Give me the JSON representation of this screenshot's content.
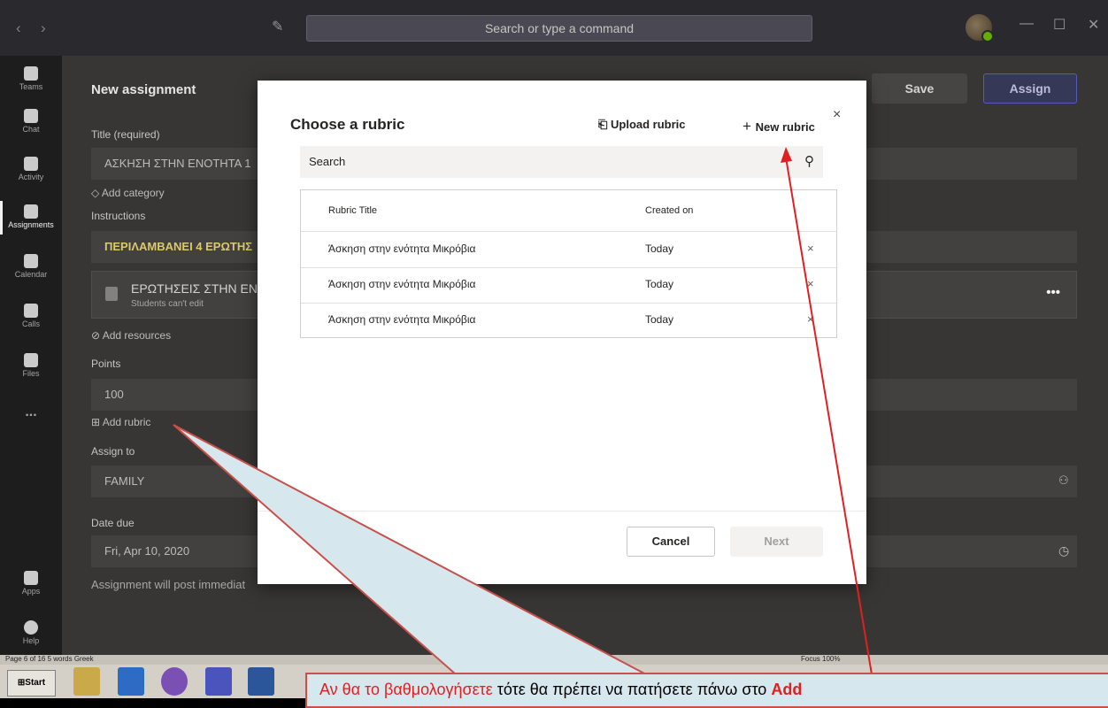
{
  "titlebar": {
    "nav_back": "‹",
    "nav_forward": "›",
    "search_placeholder": "Search or type a command",
    "minimize": "—",
    "maximize": "☐",
    "close": "✕"
  },
  "rail": [
    {
      "label": "Teams"
    },
    {
      "label": "Chat"
    },
    {
      "label": "Activity"
    },
    {
      "label": "Assignments"
    },
    {
      "label": "Calendar"
    },
    {
      "label": "Calls"
    },
    {
      "label": "Files"
    },
    {
      "label": "..."
    },
    {
      "label": "Apps"
    },
    {
      "label": "Help"
    }
  ],
  "page": {
    "title": "New assignment",
    "save": "Save",
    "assign": "Assign",
    "title_label": "Title (required)",
    "title_value": "ΑΣΚΗΣΗ ΣΤΗΝ ΕΝΟΤΗΤΑ 1",
    "add_category": "Add category",
    "instructions_label": "Instructions",
    "instructions_value": "ΠΕΡΙΛΑΜΒΑΝΕΙ 4 ΕΡΩΤΗΣ",
    "resource_title": "ΕΡΩΤΗΣΕΙΣ ΣΤΗΝ ΕΝ",
    "resource_sub": "Students can't edit",
    "more": "•••",
    "add_resources": "Add resources",
    "points_label": "Points",
    "points_value": "100",
    "add_rubric": "Add rubric",
    "assign_to_label": "Assign to",
    "assign_to_value": "FAMILY",
    "date_due_label": "Date due",
    "date_due_value": "Fri, Apr 10, 2020",
    "post_note": "Assignment will post immediat"
  },
  "modal": {
    "title": "Choose a rubric",
    "upload": "Upload rubric",
    "new": "New rubric",
    "close": "×",
    "search": "Search",
    "col_title": "Rubric Title",
    "col_created": "Created on",
    "rows": [
      {
        "title": "Άσκηση στην ενότητα Μικρόβια",
        "created": "Today"
      },
      {
        "title": "Άσκηση στην ενότητα Μικρόβια",
        "created": "Today"
      },
      {
        "title": "Άσκηση στην ενότητα Μικρόβια",
        "created": "Today"
      }
    ],
    "cancel": "Cancel",
    "next": "Next"
  },
  "statusbar": {
    "left": "Page 6 of 16    5 words    Greek",
    "right": "Focus                                        100%"
  },
  "taskbar": {
    "start": "Start"
  },
  "callout": {
    "part1": "Αν θα το βαθμολογήσετε",
    "part2": " τότε θα πρέπει να πατήσετε πάνω στο ",
    "part3": "Add"
  },
  "colors": {
    "accent": "#5b5fc7",
    "arrow": "#e02020",
    "callout_fill": "#d6e7ee",
    "callout_border": "#c9504a"
  }
}
